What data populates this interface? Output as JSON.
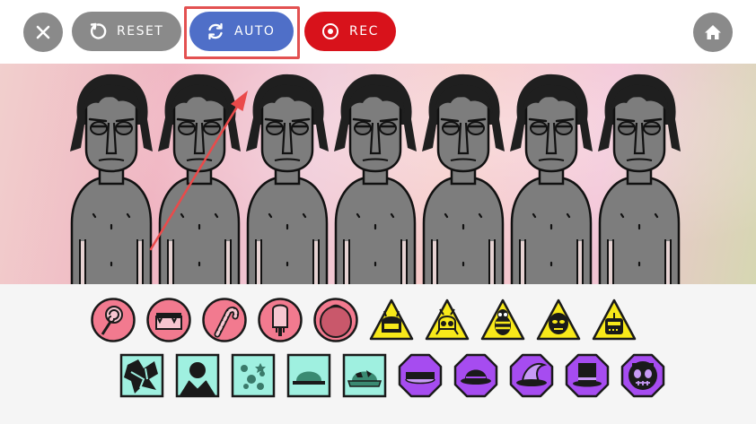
{
  "toolbar": {
    "close_icon": "close-icon",
    "reset_label": "RESET",
    "reset_icon": "reset-icon",
    "auto_label": "AUTO",
    "auto_icon": "refresh-icon",
    "rec_label": "REC",
    "rec_icon": "record-icon",
    "home_icon": "home-icon"
  },
  "colors": {
    "gray_button": "#8a8a8a",
    "auto_button": "#4f6fc8",
    "rec_button": "#d8121b",
    "highlight": "#e35151",
    "effects_row_color": "#f27a8f",
    "beats_row_color": "#f7e81a",
    "melody_row_color": "#9ff0e0",
    "voices_row_color": "#a64cf0"
  },
  "stage": {
    "characters_count": 7
  },
  "tray": {
    "row1": [
      {
        "kind": "pink-circle",
        "icon": "lollipop-icon"
      },
      {
        "kind": "pink-circle",
        "icon": "cake-icon"
      },
      {
        "kind": "pink-circle",
        "icon": "candy-cane-icon"
      },
      {
        "kind": "pink-circle",
        "icon": "popsicle-icon"
      },
      {
        "kind": "pink-circle",
        "icon": "gumball-icon"
      },
      {
        "kind": "yellow-triangle",
        "icon": "helmet-icon"
      },
      {
        "kind": "yellow-triangle",
        "icon": "bug-mask-icon"
      },
      {
        "kind": "yellow-triangle",
        "icon": "bee-icon"
      },
      {
        "kind": "yellow-triangle",
        "icon": "alien-face-icon"
      },
      {
        "kind": "yellow-triangle",
        "icon": "robot-face-icon"
      }
    ],
    "row2": [
      {
        "kind": "teal-square",
        "icon": "shattered-icon"
      },
      {
        "kind": "teal-square",
        "icon": "hooded-figure-icon"
      },
      {
        "kind": "teal-square",
        "icon": "bubbles-icon"
      },
      {
        "kind": "teal-square",
        "icon": "cap-icon"
      },
      {
        "kind": "teal-square",
        "icon": "camo-cap-icon"
      },
      {
        "kind": "purple-octagon",
        "icon": "headband-icon"
      },
      {
        "kind": "purple-octagon",
        "icon": "bowler-hat-icon"
      },
      {
        "kind": "purple-octagon",
        "icon": "witch-hat-icon"
      },
      {
        "kind": "purple-octagon",
        "icon": "top-hat-icon"
      },
      {
        "kind": "purple-octagon",
        "icon": "skull-mask-icon"
      }
    ]
  }
}
